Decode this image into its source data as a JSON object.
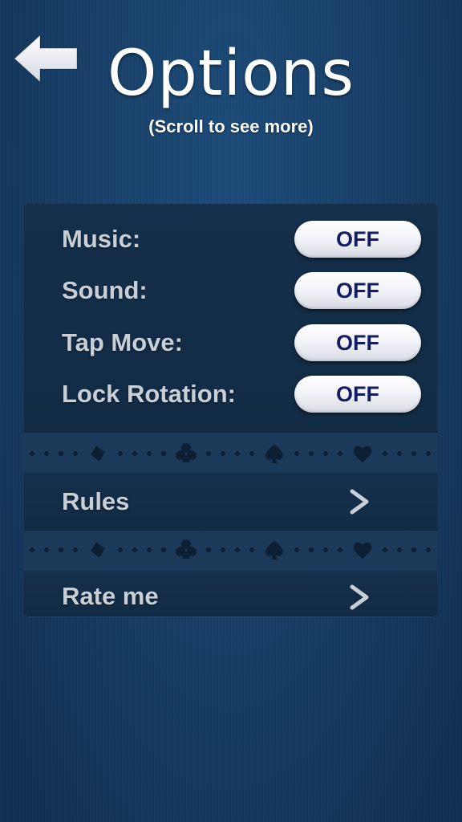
{
  "header": {
    "back_icon": "back-arrow-icon",
    "title": "Options",
    "subtitle": "(Scroll to see more)"
  },
  "options": [
    {
      "label": "Music:",
      "value": "OFF"
    },
    {
      "label": "Sound:",
      "value": "OFF"
    },
    {
      "label": "Tap Move:",
      "value": "OFF"
    },
    {
      "label": "Lock Rotation:",
      "value": "OFF"
    }
  ],
  "divider_icons": [
    "diamond-icon",
    "club-icon",
    "spade-icon",
    "heart-icon"
  ],
  "links": [
    {
      "label": "Rules",
      "icon": "chevron-right-icon"
    },
    {
      "label": "Rate me",
      "icon": "chevron-right-icon"
    }
  ],
  "colors": {
    "background": "#173f67",
    "panel": "#132d48",
    "divider": "#1b3a5a",
    "label_text": "#c9cfd6",
    "toggle_text": "#141d63"
  }
}
